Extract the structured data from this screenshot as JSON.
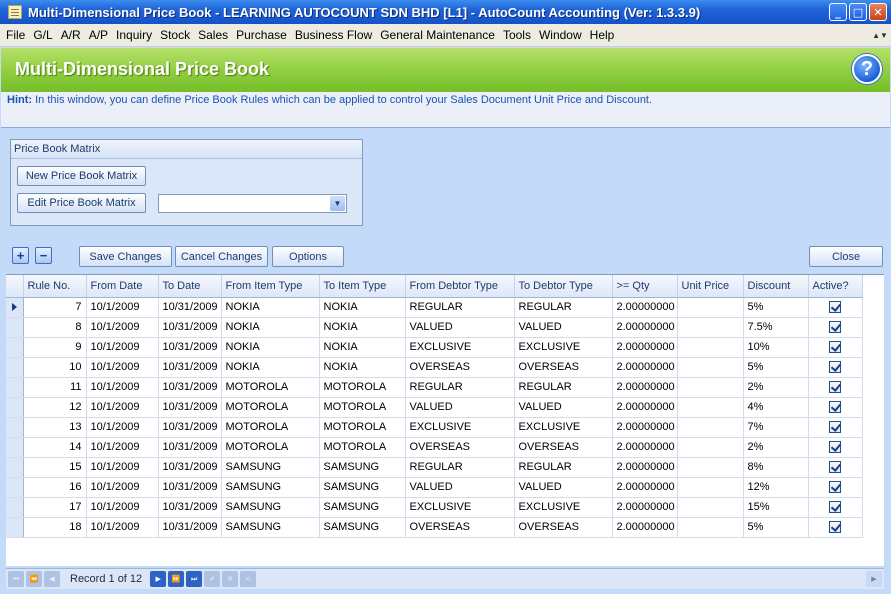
{
  "window": {
    "title": "Multi-Dimensional Price Book - LEARNING AUTOCOUNT SDN BHD [L1] - AutoCount Accounting (Ver: 1.3.3.9)",
    "min": "_",
    "max": "□",
    "close": "✕"
  },
  "menu": [
    "File",
    "G/L",
    "A/R",
    "A/P",
    "Inquiry",
    "Stock",
    "Sales",
    "Purchase",
    "Business Flow",
    "General Maintenance",
    "Tools",
    "Window",
    "Help"
  ],
  "header": {
    "title": "Multi-Dimensional Price Book",
    "help": "?"
  },
  "hint": {
    "label": "Hint:",
    "text": "In this window, you can define Price Book Rules which can be applied to control your Sales Document Unit Price and Discount."
  },
  "matrix": {
    "title": "Price Book Matrix",
    "new_label": "New Price Book Matrix",
    "edit_label": "Edit Price Book Matrix",
    "selected": ""
  },
  "toolbar": {
    "add": "+",
    "remove": "−",
    "save_label": "Save Changes",
    "cancel_label": "Cancel Changes",
    "options_label": "Options",
    "close_label": "Close"
  },
  "grid": {
    "columns": [
      "Rule No.",
      "From Date",
      "To Date",
      "From Item Type",
      "To Item Type",
      "From Debtor Type",
      "To Debtor Type",
      ">= Qty",
      "Unit Price",
      "Discount",
      "Active?"
    ],
    "rows": [
      {
        "rule": "7",
        "from_date": "10/1/2009",
        "to_date": "10/31/2009",
        "from_item": "NOKIA",
        "to_item": "NOKIA",
        "from_debtor": "REGULAR",
        "to_debtor": "REGULAR",
        "qty": "2.00000000",
        "price": "",
        "discount": "5%",
        "active": true
      },
      {
        "rule": "8",
        "from_date": "10/1/2009",
        "to_date": "10/31/2009",
        "from_item": "NOKIA",
        "to_item": "NOKIA",
        "from_debtor": "VALUED",
        "to_debtor": "VALUED",
        "qty": "2.00000000",
        "price": "",
        "discount": "7.5%",
        "active": true
      },
      {
        "rule": "9",
        "from_date": "10/1/2009",
        "to_date": "10/31/2009",
        "from_item": "NOKIA",
        "to_item": "NOKIA",
        "from_debtor": "EXCLUSIVE",
        "to_debtor": "EXCLUSIVE",
        "qty": "2.00000000",
        "price": "",
        "discount": "10%",
        "active": true
      },
      {
        "rule": "10",
        "from_date": "10/1/2009",
        "to_date": "10/31/2009",
        "from_item": "NOKIA",
        "to_item": "NOKIA",
        "from_debtor": "OVERSEAS",
        "to_debtor": "OVERSEAS",
        "qty": "2.00000000",
        "price": "",
        "discount": "5%",
        "active": true
      },
      {
        "rule": "11",
        "from_date": "10/1/2009",
        "to_date": "10/31/2009",
        "from_item": "MOTOROLA",
        "to_item": "MOTOROLA",
        "from_debtor": "REGULAR",
        "to_debtor": "REGULAR",
        "qty": "2.00000000",
        "price": "",
        "discount": "2%",
        "active": true
      },
      {
        "rule": "12",
        "from_date": "10/1/2009",
        "to_date": "10/31/2009",
        "from_item": "MOTOROLA",
        "to_item": "MOTOROLA",
        "from_debtor": "VALUED",
        "to_debtor": "VALUED",
        "qty": "2.00000000",
        "price": "",
        "discount": "4%",
        "active": true
      },
      {
        "rule": "13",
        "from_date": "10/1/2009",
        "to_date": "10/31/2009",
        "from_item": "MOTOROLA",
        "to_item": "MOTOROLA",
        "from_debtor": "EXCLUSIVE",
        "to_debtor": "EXCLUSIVE",
        "qty": "2.00000000",
        "price": "",
        "discount": "7%",
        "active": true
      },
      {
        "rule": "14",
        "from_date": "10/1/2009",
        "to_date": "10/31/2009",
        "from_item": "MOTOROLA",
        "to_item": "MOTOROLA",
        "from_debtor": "OVERSEAS",
        "to_debtor": "OVERSEAS",
        "qty": "2.00000000",
        "price": "",
        "discount": "2%",
        "active": true
      },
      {
        "rule": "15",
        "from_date": "10/1/2009",
        "to_date": "10/31/2009",
        "from_item": "SAMSUNG",
        "to_item": "SAMSUNG",
        "from_debtor": "REGULAR",
        "to_debtor": "REGULAR",
        "qty": "2.00000000",
        "price": "",
        "discount": "8%",
        "active": true
      },
      {
        "rule": "16",
        "from_date": "10/1/2009",
        "to_date": "10/31/2009",
        "from_item": "SAMSUNG",
        "to_item": "SAMSUNG",
        "from_debtor": "VALUED",
        "to_debtor": "VALUED",
        "qty": "2.00000000",
        "price": "",
        "discount": "12%",
        "active": true
      },
      {
        "rule": "17",
        "from_date": "10/1/2009",
        "to_date": "10/31/2009",
        "from_item": "SAMSUNG",
        "to_item": "SAMSUNG",
        "from_debtor": "EXCLUSIVE",
        "to_debtor": "EXCLUSIVE",
        "qty": "2.00000000",
        "price": "",
        "discount": "15%",
        "active": true
      },
      {
        "rule": "18",
        "from_date": "10/1/2009",
        "to_date": "10/31/2009",
        "from_item": "SAMSUNG",
        "to_item": "SAMSUNG",
        "from_debtor": "OVERSEAS",
        "to_debtor": "OVERSEAS",
        "qty": "2.00000000",
        "price": "",
        "discount": "5%",
        "active": true
      }
    ]
  },
  "navigator": {
    "record_text": "Record 1 of 12",
    "first": "⏮",
    "prev_page": "⏪",
    "prev": "◀",
    "next": "▶",
    "next_page": "⏩",
    "last": "⏭",
    "append": "✔",
    "delete": "✕",
    "cancel": "<"
  },
  "colors": {
    "header_green": "#8fcd3e",
    "title_blue": "#1f63d8",
    "hint_blue": "#1a53b5"
  }
}
